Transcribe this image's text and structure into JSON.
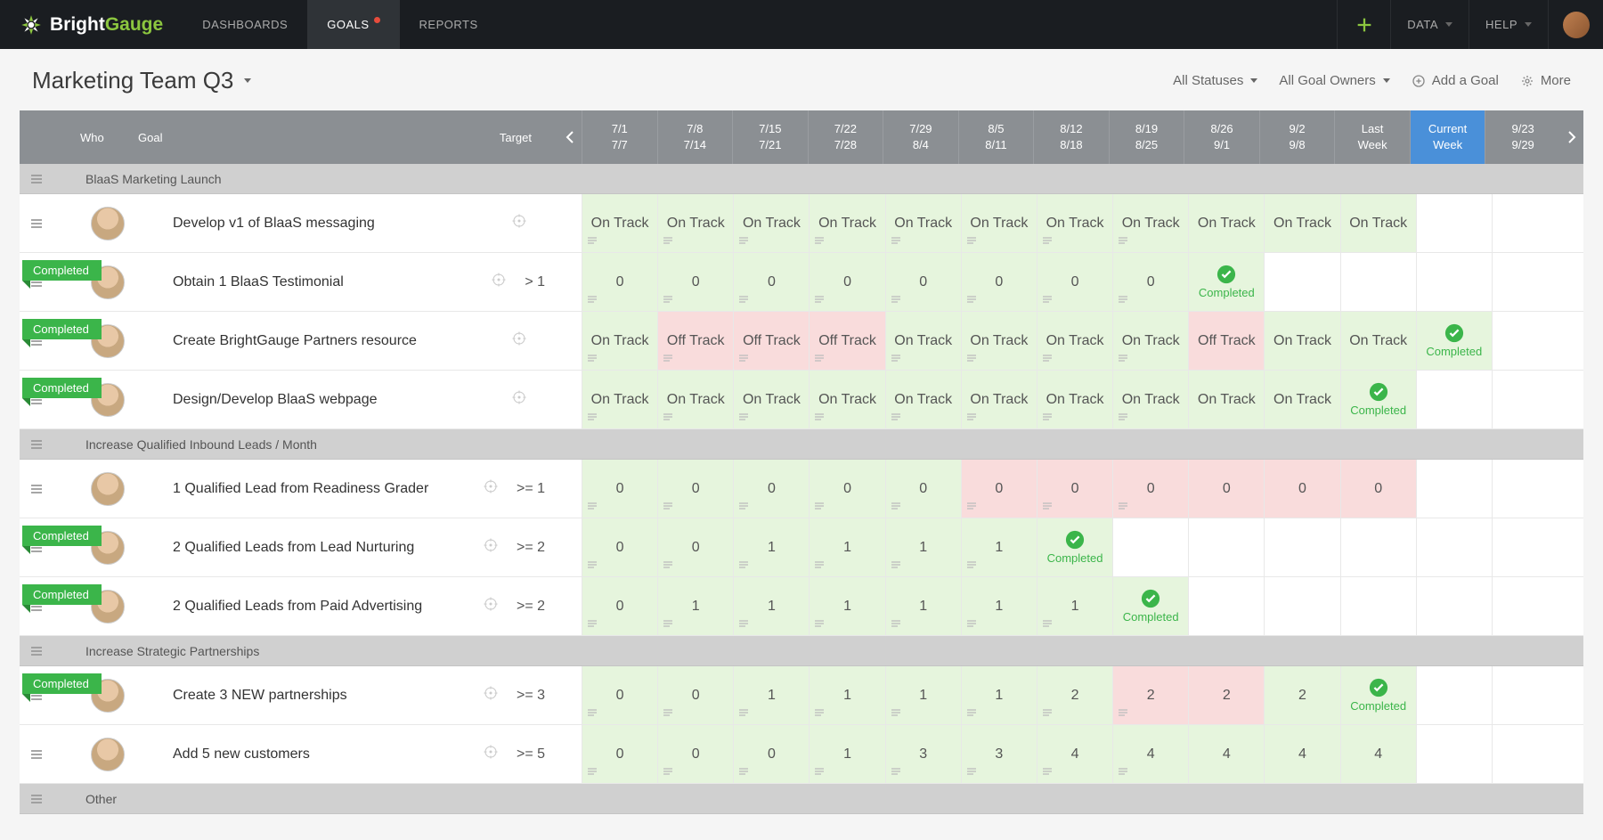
{
  "brand": {
    "name_a": "Bright",
    "name_b": "Gauge"
  },
  "nav": {
    "dashboards": "DASHBOARDS",
    "goals": "GOALS",
    "reports": "REPORTS",
    "data": "DATA",
    "help": "HELP"
  },
  "board": {
    "title": "Marketing Team Q3"
  },
  "filters": {
    "statuses": "All Statuses",
    "owners": "All Goal Owners",
    "add": "Add a Goal",
    "more": "More"
  },
  "header": {
    "who": "Who",
    "goal": "Goal",
    "target": "Target",
    "weeks": [
      {
        "top": "7/1",
        "bot": "7/7"
      },
      {
        "top": "7/8",
        "bot": "7/14"
      },
      {
        "top": "7/15",
        "bot": "7/21"
      },
      {
        "top": "7/22",
        "bot": "7/28"
      },
      {
        "top": "7/29",
        "bot": "8/4"
      },
      {
        "top": "8/5",
        "bot": "8/11"
      },
      {
        "top": "8/12",
        "bot": "8/18"
      },
      {
        "top": "8/19",
        "bot": "8/25"
      },
      {
        "top": "8/26",
        "bot": "9/1"
      },
      {
        "top": "9/2",
        "bot": "9/8"
      },
      {
        "top": "Last",
        "bot": "Week",
        "special": "last"
      },
      {
        "top": "Current",
        "bot": "Week",
        "special": "current"
      },
      {
        "top": "9/23",
        "bot": "9/29"
      }
    ]
  },
  "sections": [
    {
      "title": "BlaaS Marketing Launch",
      "goals": [
        {
          "title": "Develop v1 of BlaaS messaging",
          "target": "",
          "completed": false,
          "cells": [
            {
              "v": "On Track",
              "c": "g",
              "n": 1
            },
            {
              "v": "On Track",
              "c": "g",
              "n": 1
            },
            {
              "v": "On Track",
              "c": "g",
              "n": 1
            },
            {
              "v": "On Track",
              "c": "g",
              "n": 1
            },
            {
              "v": "On Track",
              "c": "g",
              "n": 1
            },
            {
              "v": "On Track",
              "c": "g",
              "n": 1
            },
            {
              "v": "On Track",
              "c": "g",
              "n": 1
            },
            {
              "v": "On Track",
              "c": "g",
              "n": 1
            },
            {
              "v": "On Track",
              "c": "g",
              "n": 0
            },
            {
              "v": "On Track",
              "c": "g",
              "n": 0
            },
            {
              "v": "On Track",
              "c": "g",
              "n": 0
            },
            {
              "v": "",
              "c": "e",
              "n": 0
            },
            {
              "v": "",
              "c": "e",
              "n": 0
            }
          ]
        },
        {
          "title": "Obtain 1 BlaaS Testimonial",
          "target": "> 1",
          "completed": true,
          "cells": [
            {
              "v": "0",
              "c": "g",
              "n": 1
            },
            {
              "v": "0",
              "c": "g",
              "n": 1
            },
            {
              "v": "0",
              "c": "g",
              "n": 1
            },
            {
              "v": "0",
              "c": "g",
              "n": 1
            },
            {
              "v": "0",
              "c": "g",
              "n": 1
            },
            {
              "v": "0",
              "c": "g",
              "n": 1
            },
            {
              "v": "0",
              "c": "g",
              "n": 1
            },
            {
              "v": "0",
              "c": "g",
              "n": 1
            },
            {
              "v": "Completed",
              "c": "g",
              "done": 1,
              "n": 0
            },
            {
              "v": "",
              "c": "e",
              "n": 0
            },
            {
              "v": "",
              "c": "e",
              "n": 0
            },
            {
              "v": "",
              "c": "e",
              "n": 0
            },
            {
              "v": "",
              "c": "e",
              "n": 0
            }
          ]
        },
        {
          "title": "Create BrightGauge Partners resource",
          "target": "",
          "completed": true,
          "cells": [
            {
              "v": "On Track",
              "c": "g",
              "n": 1
            },
            {
              "v": "Off Track",
              "c": "r",
              "n": 1
            },
            {
              "v": "Off Track",
              "c": "r",
              "n": 1
            },
            {
              "v": "Off Track",
              "c": "r",
              "n": 1
            },
            {
              "v": "On Track",
              "c": "g",
              "n": 1
            },
            {
              "v": "On Track",
              "c": "g",
              "n": 1
            },
            {
              "v": "On Track",
              "c": "g",
              "n": 1
            },
            {
              "v": "On Track",
              "c": "g",
              "n": 1
            },
            {
              "v": "Off Track",
              "c": "r",
              "n": 0
            },
            {
              "v": "On Track",
              "c": "g",
              "n": 0
            },
            {
              "v": "On Track",
              "c": "g",
              "n": 0
            },
            {
              "v": "Completed",
              "c": "g",
              "done": 1,
              "n": 0
            },
            {
              "v": "",
              "c": "e",
              "n": 0
            }
          ]
        },
        {
          "title": "Design/Develop BlaaS webpage",
          "target": "",
          "completed": true,
          "cells": [
            {
              "v": "On Track",
              "c": "g",
              "n": 1
            },
            {
              "v": "On Track",
              "c": "g",
              "n": 1
            },
            {
              "v": "On Track",
              "c": "g",
              "n": 1
            },
            {
              "v": "On Track",
              "c": "g",
              "n": 1
            },
            {
              "v": "On Track",
              "c": "g",
              "n": 1
            },
            {
              "v": "On Track",
              "c": "g",
              "n": 1
            },
            {
              "v": "On Track",
              "c": "g",
              "n": 1
            },
            {
              "v": "On Track",
              "c": "g",
              "n": 1
            },
            {
              "v": "On Track",
              "c": "g",
              "n": 0
            },
            {
              "v": "On Track",
              "c": "g",
              "n": 0
            },
            {
              "v": "Completed",
              "c": "g",
              "done": 1,
              "n": 0
            },
            {
              "v": "",
              "c": "e",
              "n": 0
            },
            {
              "v": "",
              "c": "e",
              "n": 0
            }
          ]
        }
      ]
    },
    {
      "title": "Increase Qualified Inbound Leads / Month",
      "goals": [
        {
          "title": "1 Qualified Lead from Readiness Grader",
          "target": ">= 1",
          "completed": false,
          "cells": [
            {
              "v": "0",
              "c": "g",
              "n": 1
            },
            {
              "v": "0",
              "c": "g",
              "n": 1
            },
            {
              "v": "0",
              "c": "g",
              "n": 1
            },
            {
              "v": "0",
              "c": "g",
              "n": 1
            },
            {
              "v": "0",
              "c": "g",
              "n": 1
            },
            {
              "v": "0",
              "c": "r",
              "n": 1
            },
            {
              "v": "0",
              "c": "r",
              "n": 1
            },
            {
              "v": "0",
              "c": "r",
              "n": 1
            },
            {
              "v": "0",
              "c": "r",
              "n": 0
            },
            {
              "v": "0",
              "c": "r",
              "n": 0
            },
            {
              "v": "0",
              "c": "r",
              "n": 0
            },
            {
              "v": "",
              "c": "e",
              "n": 0
            },
            {
              "v": "",
              "c": "e",
              "n": 0
            }
          ]
        },
        {
          "title": "2 Qualified Leads from Lead Nurturing",
          "target": ">= 2",
          "completed": true,
          "cells": [
            {
              "v": "0",
              "c": "g",
              "n": 1
            },
            {
              "v": "0",
              "c": "g",
              "n": 1
            },
            {
              "v": "1",
              "c": "g",
              "n": 1
            },
            {
              "v": "1",
              "c": "g",
              "n": 1
            },
            {
              "v": "1",
              "c": "g",
              "n": 1
            },
            {
              "v": "1",
              "c": "g",
              "n": 1
            },
            {
              "v": "Completed",
              "c": "g",
              "done": 1,
              "n": 0
            },
            {
              "v": "",
              "c": "e",
              "n": 0
            },
            {
              "v": "",
              "c": "e",
              "n": 0
            },
            {
              "v": "",
              "c": "e",
              "n": 0
            },
            {
              "v": "",
              "c": "e",
              "n": 0
            },
            {
              "v": "",
              "c": "e",
              "n": 0
            },
            {
              "v": "",
              "c": "e",
              "n": 0
            }
          ]
        },
        {
          "title": "2 Qualified Leads from Paid Advertising",
          "target": ">= 2",
          "completed": true,
          "cells": [
            {
              "v": "0",
              "c": "g",
              "n": 1
            },
            {
              "v": "1",
              "c": "g",
              "n": 1
            },
            {
              "v": "1",
              "c": "g",
              "n": 1
            },
            {
              "v": "1",
              "c": "g",
              "n": 1
            },
            {
              "v": "1",
              "c": "g",
              "n": 1
            },
            {
              "v": "1",
              "c": "g",
              "n": 1
            },
            {
              "v": "1",
              "c": "g",
              "n": 1
            },
            {
              "v": "Completed",
              "c": "g",
              "done": 1,
              "n": 0
            },
            {
              "v": "",
              "c": "e",
              "n": 0
            },
            {
              "v": "",
              "c": "e",
              "n": 0
            },
            {
              "v": "",
              "c": "e",
              "n": 0
            },
            {
              "v": "",
              "c": "e",
              "n": 0
            },
            {
              "v": "",
              "c": "e",
              "n": 0
            }
          ]
        }
      ]
    },
    {
      "title": "Increase Strategic Partnerships",
      "goals": [
        {
          "title": "Create 3 NEW partnerships",
          "target": ">= 3",
          "completed": true,
          "cells": [
            {
              "v": "0",
              "c": "g",
              "n": 1
            },
            {
              "v": "0",
              "c": "g",
              "n": 1
            },
            {
              "v": "1",
              "c": "g",
              "n": 1
            },
            {
              "v": "1",
              "c": "g",
              "n": 1
            },
            {
              "v": "1",
              "c": "g",
              "n": 1
            },
            {
              "v": "1",
              "c": "g",
              "n": 1
            },
            {
              "v": "2",
              "c": "g",
              "n": 1
            },
            {
              "v": "2",
              "c": "r",
              "n": 1
            },
            {
              "v": "2",
              "c": "r",
              "n": 0
            },
            {
              "v": "2",
              "c": "g",
              "n": 0
            },
            {
              "v": "Completed",
              "c": "g",
              "done": 1,
              "n": 0
            },
            {
              "v": "",
              "c": "e",
              "n": 0
            },
            {
              "v": "",
              "c": "e",
              "n": 0
            }
          ]
        },
        {
          "title": "Add 5 new customers",
          "target": ">= 5",
          "completed": false,
          "cells": [
            {
              "v": "0",
              "c": "g",
              "n": 1
            },
            {
              "v": "0",
              "c": "g",
              "n": 1
            },
            {
              "v": "0",
              "c": "g",
              "n": 1
            },
            {
              "v": "1",
              "c": "g",
              "n": 1
            },
            {
              "v": "3",
              "c": "g",
              "n": 1
            },
            {
              "v": "3",
              "c": "g",
              "n": 1
            },
            {
              "v": "4",
              "c": "g",
              "n": 1
            },
            {
              "v": "4",
              "c": "g",
              "n": 1
            },
            {
              "v": "4",
              "c": "g",
              "n": 0
            },
            {
              "v": "4",
              "c": "g",
              "n": 0
            },
            {
              "v": "4",
              "c": "g",
              "n": 0
            },
            {
              "v": "",
              "c": "e",
              "n": 0
            },
            {
              "v": "",
              "c": "e",
              "n": 0
            }
          ]
        }
      ]
    },
    {
      "title": "Other",
      "goals": []
    }
  ],
  "labels": {
    "completed_badge": "Completed",
    "completed_cell": "Completed"
  }
}
